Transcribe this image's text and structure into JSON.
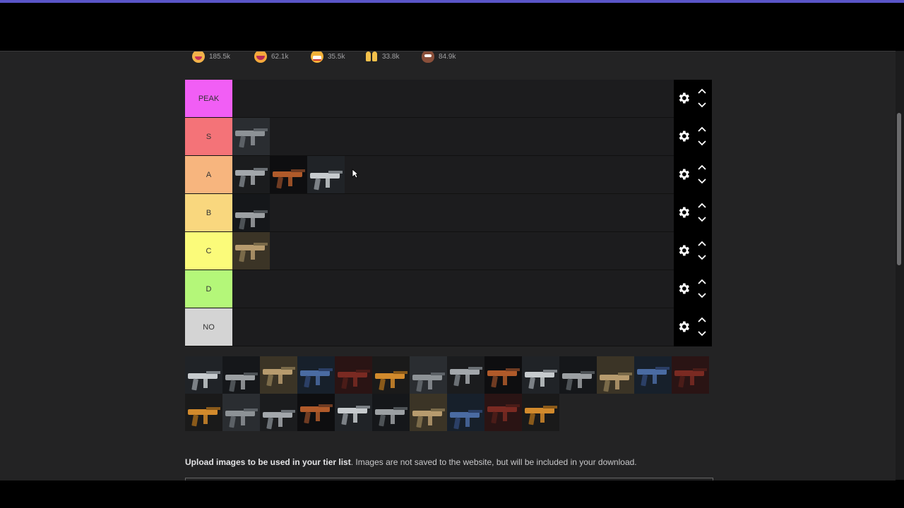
{
  "reactions": [
    {
      "icon": "smile-emoji-icon",
      "count": "185.5k"
    },
    {
      "icon": "laugh-emoji-icon",
      "count": "62.1k"
    },
    {
      "icon": "grin-emoji-icon",
      "count": "35.5k"
    },
    {
      "icon": "raised-hands-emoji-icon",
      "count": "33.8k"
    },
    {
      "icon": "poop-emoji-icon",
      "count": "84.9k"
    }
  ],
  "tiers": [
    {
      "label": "PEAK",
      "color": "#f15ef5",
      "items": 0
    },
    {
      "label": "S",
      "color": "#f47378",
      "items": 1
    },
    {
      "label": "A",
      "color": "#f7b57e",
      "items": 3
    },
    {
      "label": "B",
      "color": "#f9d77e",
      "items": 1
    },
    {
      "label": "C",
      "color": "#fbfb7a",
      "items": 1
    },
    {
      "label": "D",
      "color": "#b4f779",
      "items": 0
    },
    {
      "label": "NO",
      "color": "#d4d4d4",
      "items": 0
    }
  ],
  "pool_count": 24,
  "upload": {
    "bold": "Upload images to be used in your tier list",
    "rest": ". Images are not saved to the website, but will be included in your download."
  },
  "colors": {
    "page_bg": "#232324",
    "row_bg": "#1c1c1e",
    "controls_bg": "#000000",
    "accent_bar": "#5a55c8"
  }
}
